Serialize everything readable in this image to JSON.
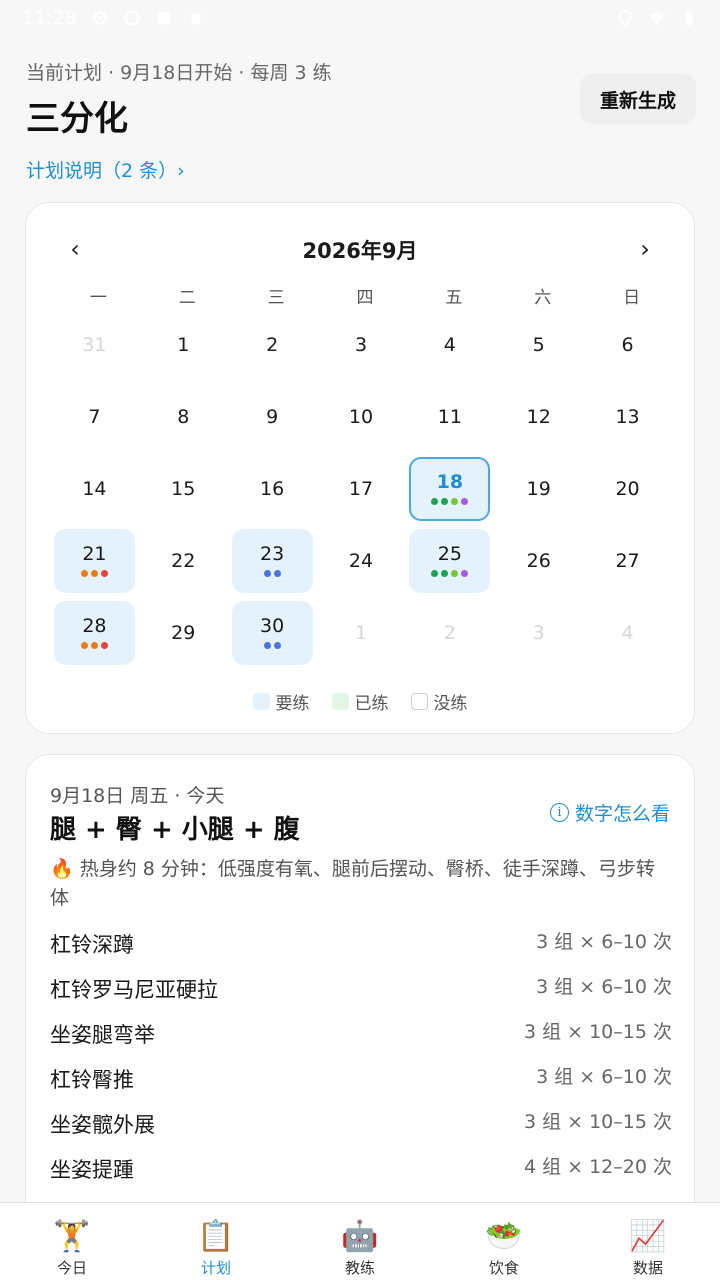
{
  "status": {
    "time": "11:28"
  },
  "plan": {
    "subtitle": "当前计划 · 9月18日开始 · 每周 3 练",
    "title": "三分化",
    "regenerate_label": "重新生成",
    "note_link": "计划说明（2 条）›"
  },
  "calendar": {
    "prev": "‹",
    "next": "›",
    "title": "2026年9月",
    "weekdays": [
      "一",
      "二",
      "三",
      "四",
      "五",
      "六",
      "日"
    ],
    "days": [
      {
        "n": "31",
        "muted": true
      },
      {
        "n": "1"
      },
      {
        "n": "2"
      },
      {
        "n": "3"
      },
      {
        "n": "4"
      },
      {
        "n": "5"
      },
      {
        "n": "6"
      },
      {
        "n": "7"
      },
      {
        "n": "8"
      },
      {
        "n": "9"
      },
      {
        "n": "10"
      },
      {
        "n": "11"
      },
      {
        "n": "12"
      },
      {
        "n": "13"
      },
      {
        "n": "14"
      },
      {
        "n": "15"
      },
      {
        "n": "16"
      },
      {
        "n": "17"
      },
      {
        "n": "18",
        "today": true,
        "dots": [
          "#1aa34a",
          "#1aa34a",
          "#7bc63a",
          "#a65be8"
        ]
      },
      {
        "n": "19"
      },
      {
        "n": "20"
      },
      {
        "n": "21",
        "planned": true,
        "dots": [
          "#f07a1a",
          "#f07a1a",
          "#e8413a"
        ]
      },
      {
        "n": "22"
      },
      {
        "n": "23",
        "planned": true,
        "dots": [
          "#4a72e0",
          "#4a72e0"
        ]
      },
      {
        "n": "24"
      },
      {
        "n": "25",
        "planned": true,
        "dots": [
          "#1aa34a",
          "#1aa34a",
          "#7bc63a",
          "#a65be8"
        ]
      },
      {
        "n": "26"
      },
      {
        "n": "27"
      },
      {
        "n": "28",
        "planned": true,
        "dots": [
          "#f07a1a",
          "#f07a1a",
          "#e8413a"
        ]
      },
      {
        "n": "29"
      },
      {
        "n": "30",
        "planned": true,
        "dots": [
          "#4a72e0",
          "#4a72e0"
        ]
      },
      {
        "n": "1",
        "muted": true
      },
      {
        "n": "2",
        "muted": true
      },
      {
        "n": "3",
        "muted": true
      },
      {
        "n": "4",
        "muted": true
      }
    ],
    "legend": {
      "planned": "要练",
      "done": "已练",
      "none": "没练"
    }
  },
  "day_detail": {
    "subtitle": "9月18日 周五 · 今天",
    "title": "腿 + 臀 + 小腿 + 腹",
    "help_link": "数字怎么看",
    "warmup_icon": "🔥",
    "warmup": "热身约 8 分钟：低强度有氧、腿前后摆动、臀桥、徒手深蹲、弓步转体",
    "exercises": [
      {
        "name": "杠铃深蹲",
        "sets": "3 组 × 6–10 次"
      },
      {
        "name": "杠铃罗马尼亚硬拉",
        "sets": "3 组 × 6–10 次"
      },
      {
        "name": "坐姿腿弯举",
        "sets": "3 组 × 10–15 次"
      },
      {
        "name": "杠铃臀推",
        "sets": "3 组 × 6–10 次"
      },
      {
        "name": "坐姿髋外展",
        "sets": "3 组 × 10–15 次"
      },
      {
        "name": "坐姿提踵",
        "sets": "4 组 × 12–20 次"
      }
    ]
  },
  "nav": [
    {
      "label": "今日",
      "icon": "🏋️",
      "icon_name": "weightlifter-icon",
      "active": false
    },
    {
      "label": "计划",
      "icon": "📋",
      "icon_name": "clipboard-icon",
      "active": true
    },
    {
      "label": "教练",
      "icon": "🤖",
      "icon_name": "robot-icon",
      "active": false
    },
    {
      "label": "饮食",
      "icon": "🥗",
      "icon_name": "salad-icon",
      "active": false
    },
    {
      "label": "数据",
      "icon": "📈",
      "icon_name": "chart-icon",
      "active": false
    }
  ],
  "colors": {
    "accent": "#1f8fd1",
    "planned_bg": "#e3f2fc",
    "done_bg": "#e2f5e6"
  }
}
